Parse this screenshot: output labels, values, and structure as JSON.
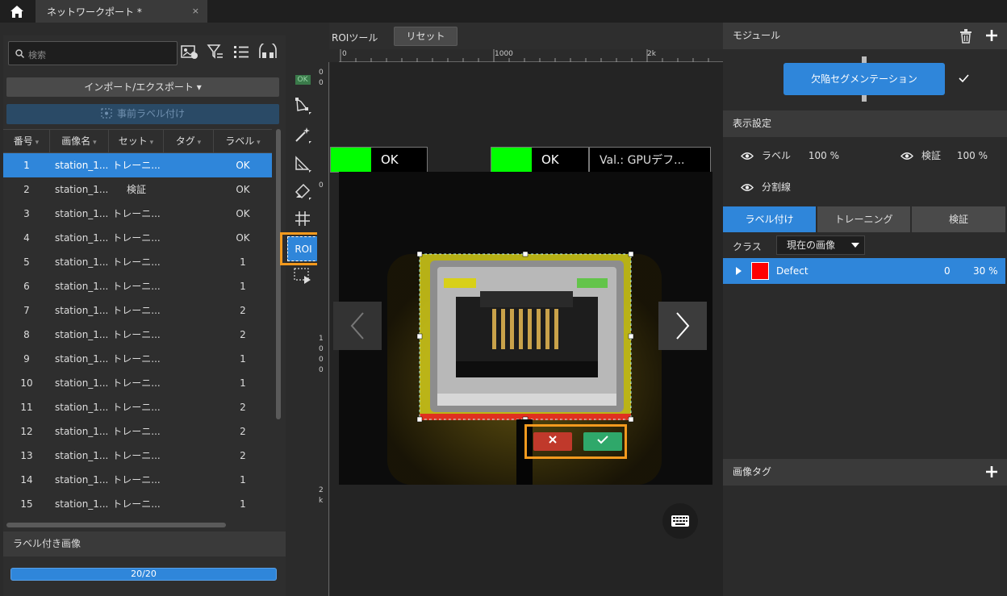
{
  "tab": {
    "title": "ネットワークポート *",
    "close": "×"
  },
  "left": {
    "search_placeholder": "検索",
    "import_export": "インポート/エクスポート ▾",
    "pre_label": "事前ラベル付け",
    "columns": [
      "番号",
      "画像名",
      "セット",
      "タグ",
      "ラベル"
    ],
    "rows": [
      {
        "no": "1",
        "name": "station_1...",
        "set": "トレーニ...",
        "label": "OK"
      },
      {
        "no": "2",
        "name": "station_1...",
        "set": "検証",
        "label": "OK"
      },
      {
        "no": "3",
        "name": "station_1...",
        "set": "トレーニ...",
        "label": "OK"
      },
      {
        "no": "4",
        "name": "station_1...",
        "set": "トレーニ...",
        "label": "OK"
      },
      {
        "no": "5",
        "name": "station_1...",
        "set": "トレーニ...",
        "label": "1"
      },
      {
        "no": "6",
        "name": "station_1...",
        "set": "トレーニ...",
        "label": "1"
      },
      {
        "no": "7",
        "name": "station_1...",
        "set": "トレーニ...",
        "label": "2"
      },
      {
        "no": "8",
        "name": "station_1...",
        "set": "トレーニ...",
        "label": "2"
      },
      {
        "no": "9",
        "name": "station_1...",
        "set": "トレーニ...",
        "label": "1"
      },
      {
        "no": "10",
        "name": "station_1...",
        "set": "トレーニ...",
        "label": "1"
      },
      {
        "no": "11",
        "name": "station_1...",
        "set": "トレーニ...",
        "label": "2"
      },
      {
        "no": "12",
        "name": "station_1...",
        "set": "トレーニ...",
        "label": "2"
      },
      {
        "no": "13",
        "name": "station_1...",
        "set": "トレーニ...",
        "label": "2"
      },
      {
        "no": "14",
        "name": "station_1...",
        "set": "トレーニ...",
        "label": "1"
      },
      {
        "no": "15",
        "name": "station_1...",
        "set": "トレーニ...",
        "label": "1"
      }
    ],
    "labeled_images": "ラベル付き画像",
    "progress_text": "20/20",
    "progress_fraction": 1.0
  },
  "tools": {
    "ok_badge": "OK",
    "roi_label": "ROI"
  },
  "canvas": {
    "roi_tool": "ROIツール",
    "reset": "リセット",
    "ruler_top": [
      "0",
      "1000",
      "2k"
    ],
    "ruler_left": [
      "0",
      "0",
      "0",
      "1",
      "0",
      "0",
      "0",
      "2",
      "k"
    ],
    "result1": "OK",
    "result2": "OK",
    "result3": "Val.: GPUデフ..."
  },
  "right": {
    "module_title": "モジュール",
    "module_button": "欠陥セグメンテーション",
    "display_title": "表示設定",
    "label_eye": "ラベル",
    "label_pct": "100 %",
    "verify_eye": "検証",
    "verify_pct": "100 %",
    "divider_eye": "分割線",
    "tabs": [
      "ラベル付け",
      "トレーニング",
      "検証"
    ],
    "class_label": "クラス",
    "class_select": "現在の画像",
    "class_row": {
      "name": "Defect",
      "count": "0",
      "pct": "30 %",
      "color": "#ff0000"
    },
    "image_tag_title": "画像タグ"
  },
  "colors": {
    "accent": "#2f86da",
    "highlight": "#f39a1e",
    "ok_green": "#00ff00"
  }
}
